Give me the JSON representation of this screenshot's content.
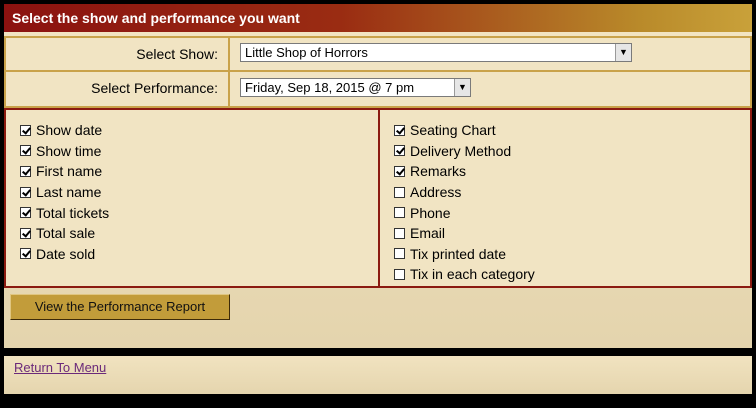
{
  "header": {
    "title": "Select the show and performance you want"
  },
  "show": {
    "label": "Select Show:",
    "value": "Little Shop of Horrors"
  },
  "performance": {
    "label": "Select Performance:",
    "value": "Friday, Sep 18, 2015 @ 7 pm"
  },
  "options": {
    "left": [
      {
        "label": "Show date",
        "checked": true
      },
      {
        "label": "Show time",
        "checked": true
      },
      {
        "label": "First name",
        "checked": true
      },
      {
        "label": "Last name",
        "checked": true
      },
      {
        "label": "Total tickets",
        "checked": true
      },
      {
        "label": "Total sale",
        "checked": true
      },
      {
        "label": "Date sold",
        "checked": true
      }
    ],
    "right": [
      {
        "label": "Seating Chart",
        "checked": true
      },
      {
        "label": "Delivery Method",
        "checked": true
      },
      {
        "label": "Remarks",
        "checked": true
      },
      {
        "label": "Address",
        "checked": false
      },
      {
        "label": "Phone",
        "checked": false
      },
      {
        "label": "Email",
        "checked": false
      },
      {
        "label": "Tix printed date",
        "checked": false
      },
      {
        "label": "Tix in each category",
        "checked": false
      }
    ]
  },
  "actions": {
    "view_report_label": "View the Performance Report"
  },
  "footer": {
    "return_link": "Return To Menu"
  }
}
